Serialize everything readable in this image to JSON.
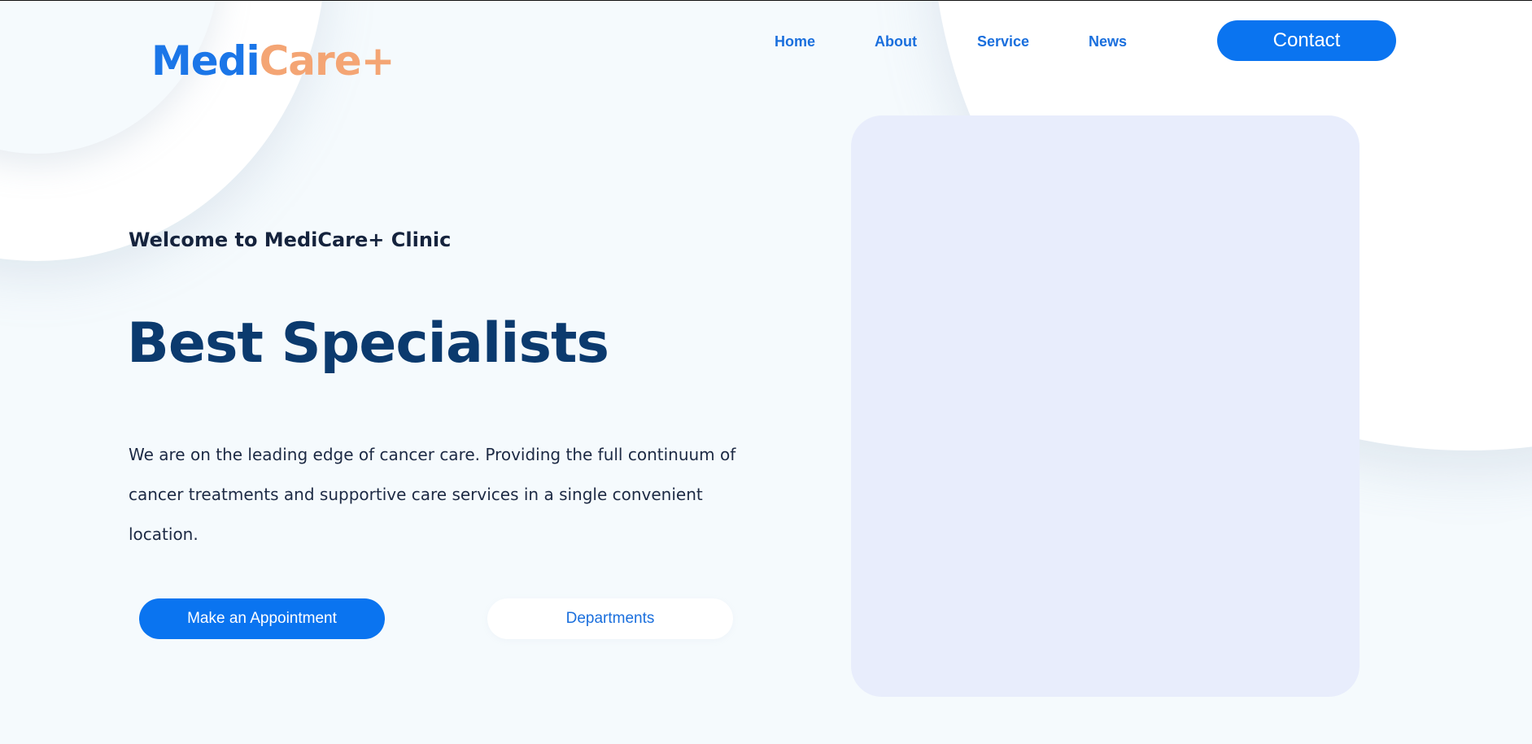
{
  "brand": {
    "logo_part1": "Medi",
    "logo_part2": "Care+",
    "primary_color": "#0a74f0",
    "accent_color": "#f4a574"
  },
  "nav": {
    "items": [
      {
        "label": "Home"
      },
      {
        "label": "About"
      },
      {
        "label": "Service"
      },
      {
        "label": "News"
      }
    ],
    "contact_label": "Contact"
  },
  "hero": {
    "welcome": "Welcome to MediCare+ Clinic",
    "headline": "Best Specialists",
    "description": "We are on the leading edge of cancer care. Providing the full continuum of cancer treatments and supportive care services in a single convenient location.",
    "primary_button": "Make an Appointment",
    "secondary_button": "Departments"
  }
}
